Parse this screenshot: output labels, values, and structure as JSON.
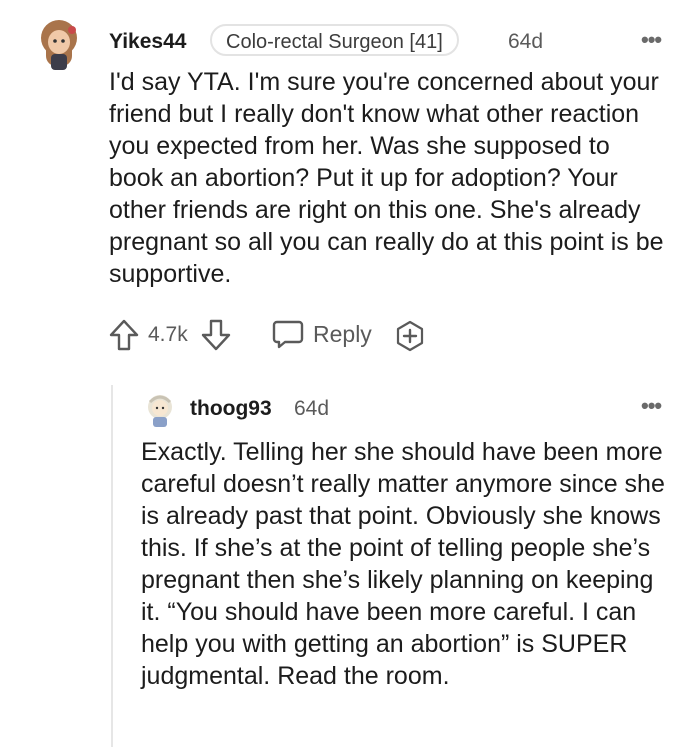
{
  "comment": {
    "username": "Yikes44",
    "flair": "Colo-rectal Surgeon [41]",
    "age": "64d",
    "more_label": "•••",
    "body": "I'd say YTA. I'm sure you're concerned about your friend but I really don't know what other reaction you expected from her. Was she supposed to book an abortion? Put it up for adoption? Your other friends are right on this one. She's already pregnant so all you can really do at this point is be supportive.",
    "score": "4.7k",
    "reply_label": "Reply"
  },
  "reply": {
    "username": "thoog93",
    "age": "64d",
    "more_label": "•••",
    "body": "Exactly. Telling her she should have been more careful doesn’t really matter anymore since she is already past that point. Obviously she knows this. If she’s at the point of telling people she’s pregnant then she’s likely planning on keeping it. “You should have been more careful. I can help you with getting an abortion” is SUPER judgmental. Read the room."
  }
}
